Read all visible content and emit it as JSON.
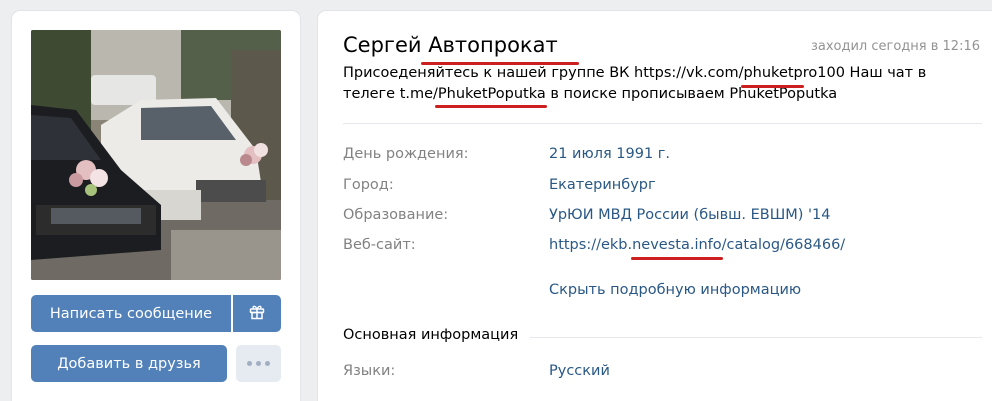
{
  "profile": {
    "name": "Сергей Автопрокат",
    "last_seen": "заходил сегодня в 12:16",
    "status_line1": "Присоеденяйтесь к нашей группе ВК https://vk.com/phuketpro100 Наш чат в",
    "status_line2": "телеге t.me/PhuketPoputka в поиске прописываем PhuketPoputka"
  },
  "details": [
    {
      "label": "День рождения:",
      "value": "21 июля 1991 г."
    },
    {
      "label": "Город:",
      "value": "Екатеринбург"
    },
    {
      "label": "Образование:",
      "value": "УрЮИ МВД России (бывш. ЕВШМ) '14"
    },
    {
      "label": "Веб-сайт:",
      "value": "https://ekb.nevesta.info/catalog/668466/"
    }
  ],
  "hide_details_label": "Скрыть подробную информацию",
  "main_info": {
    "title": "Основная информация",
    "languages_label": "Языки:",
    "languages_value": "Русский"
  },
  "actions": {
    "write_message": "Написать сообщение",
    "add_friend": "Добавить в друзья",
    "gift_icon": "gift-icon",
    "more_icon": "more-dots-icon"
  },
  "colors": {
    "page_bg": "#edeef0",
    "button_blue": "#5181b8",
    "link_blue": "#2a5885",
    "label_gray": "#828282",
    "annotation_red": "#cc1f1f"
  }
}
